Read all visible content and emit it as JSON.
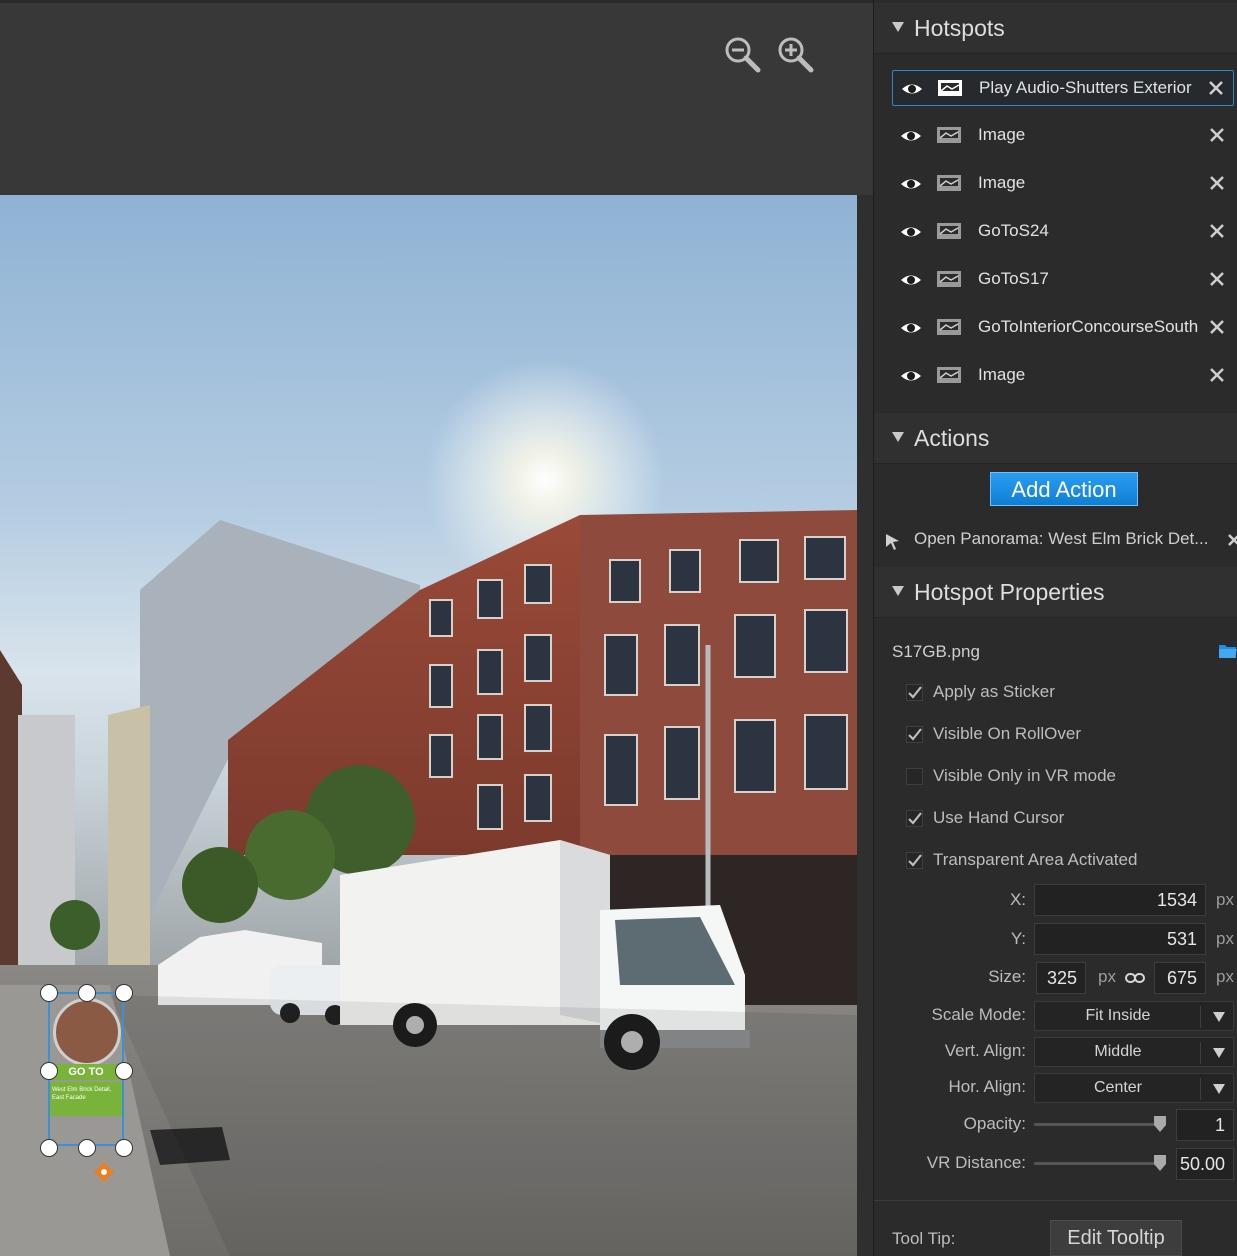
{
  "workspace": {
    "zoom_out_icon": "zoom-out-icon",
    "zoom_in_icon": "zoom-in-icon"
  },
  "sticker": {
    "goto_text": "GO TO",
    "caption_line1": "West Elm Brick Detail,",
    "caption_line2": "East Facade"
  },
  "panel": {
    "hotspots": {
      "title": "Hotspots",
      "items": [
        {
          "label": "Play Audio-Shutters Exterior",
          "selected": true
        },
        {
          "label": "Image",
          "selected": false
        },
        {
          "label": "Image",
          "selected": false
        },
        {
          "label": "GoToS24",
          "selected": false
        },
        {
          "label": "GoToS17",
          "selected": false
        },
        {
          "label": "GoToInteriorConcourseSouth",
          "selected": false
        },
        {
          "label": "Image",
          "selected": false
        }
      ]
    },
    "actions": {
      "title": "Actions",
      "add_button": "Add Action",
      "items": [
        {
          "label": "Open Panorama: West Elm Brick Det..."
        }
      ]
    },
    "properties": {
      "title": "Hotspot Properties",
      "file_name": "S17GB.png",
      "checkboxes": [
        {
          "label": "Apply as Sticker",
          "checked": true
        },
        {
          "label": "Visible On RollOver",
          "checked": true
        },
        {
          "label": "Visible Only in VR mode",
          "checked": false
        },
        {
          "label": "Use Hand Cursor",
          "checked": true
        },
        {
          "label": "Transparent Area Activated",
          "checked": true
        }
      ],
      "x_label": "X:",
      "x_value": "1534",
      "y_label": "Y:",
      "y_value": "531",
      "size_label": "Size:",
      "size_w": "325",
      "size_h": "675",
      "unit": "px",
      "scale_mode_label": "Scale Mode:",
      "scale_mode": "Fit Inside",
      "vert_align_label": "Vert. Align:",
      "vert_align": "Middle",
      "hor_align_label": "Hor. Align:",
      "hor_align": "Center",
      "opacity_label": "Opacity:",
      "opacity_value": "1",
      "opacity_fraction": 1.0,
      "vr_distance_label": "VR Distance:",
      "vr_distance_value": "50.00",
      "vr_distance_fraction": 1.0,
      "tooltip_label": "Tool Tip:",
      "tooltip_button": "Edit Tooltip"
    }
  },
  "colors": {
    "accent_blue": "#1a8fe3",
    "selection_border": "#2f86c9",
    "sticker_green": "#79b33a",
    "handle_blue": "#3d8fd6"
  }
}
